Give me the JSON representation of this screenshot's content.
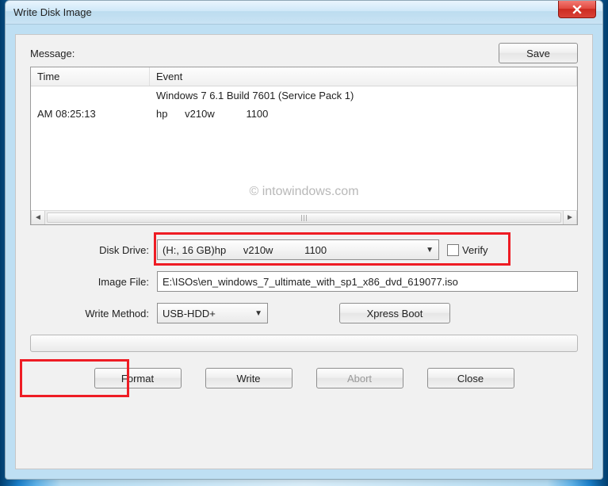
{
  "window": {
    "title": "Write Disk Image"
  },
  "topbar": {
    "message_label": "Message:",
    "save_label": "Save"
  },
  "list": {
    "headers": {
      "time": "Time",
      "event": "Event"
    },
    "rows": [
      {
        "time": "",
        "event": "Windows 7 6.1 Build 7601 (Service Pack 1)"
      },
      {
        "time": "AM 08:25:13",
        "event": "hp      v210w           1100"
      }
    ]
  },
  "watermark": "© intowindows.com",
  "form": {
    "disk_drive_label": "Disk Drive:",
    "disk_drive_value": "(H:, 16 GB)hp      v210w           1100",
    "verify_label": "Verify",
    "verify_checked": false,
    "image_file_label": "Image File:",
    "image_file_value": "E:\\ISOs\\en_windows_7_ultimate_with_sp1_x86_dvd_619077.iso",
    "write_method_label": "Write Method:",
    "write_method_value": "USB-HDD+",
    "xpress_boot_label": "Xpress Boot"
  },
  "buttons": {
    "format": "Format",
    "write": "Write",
    "abort": "Abort",
    "close": "Close"
  }
}
